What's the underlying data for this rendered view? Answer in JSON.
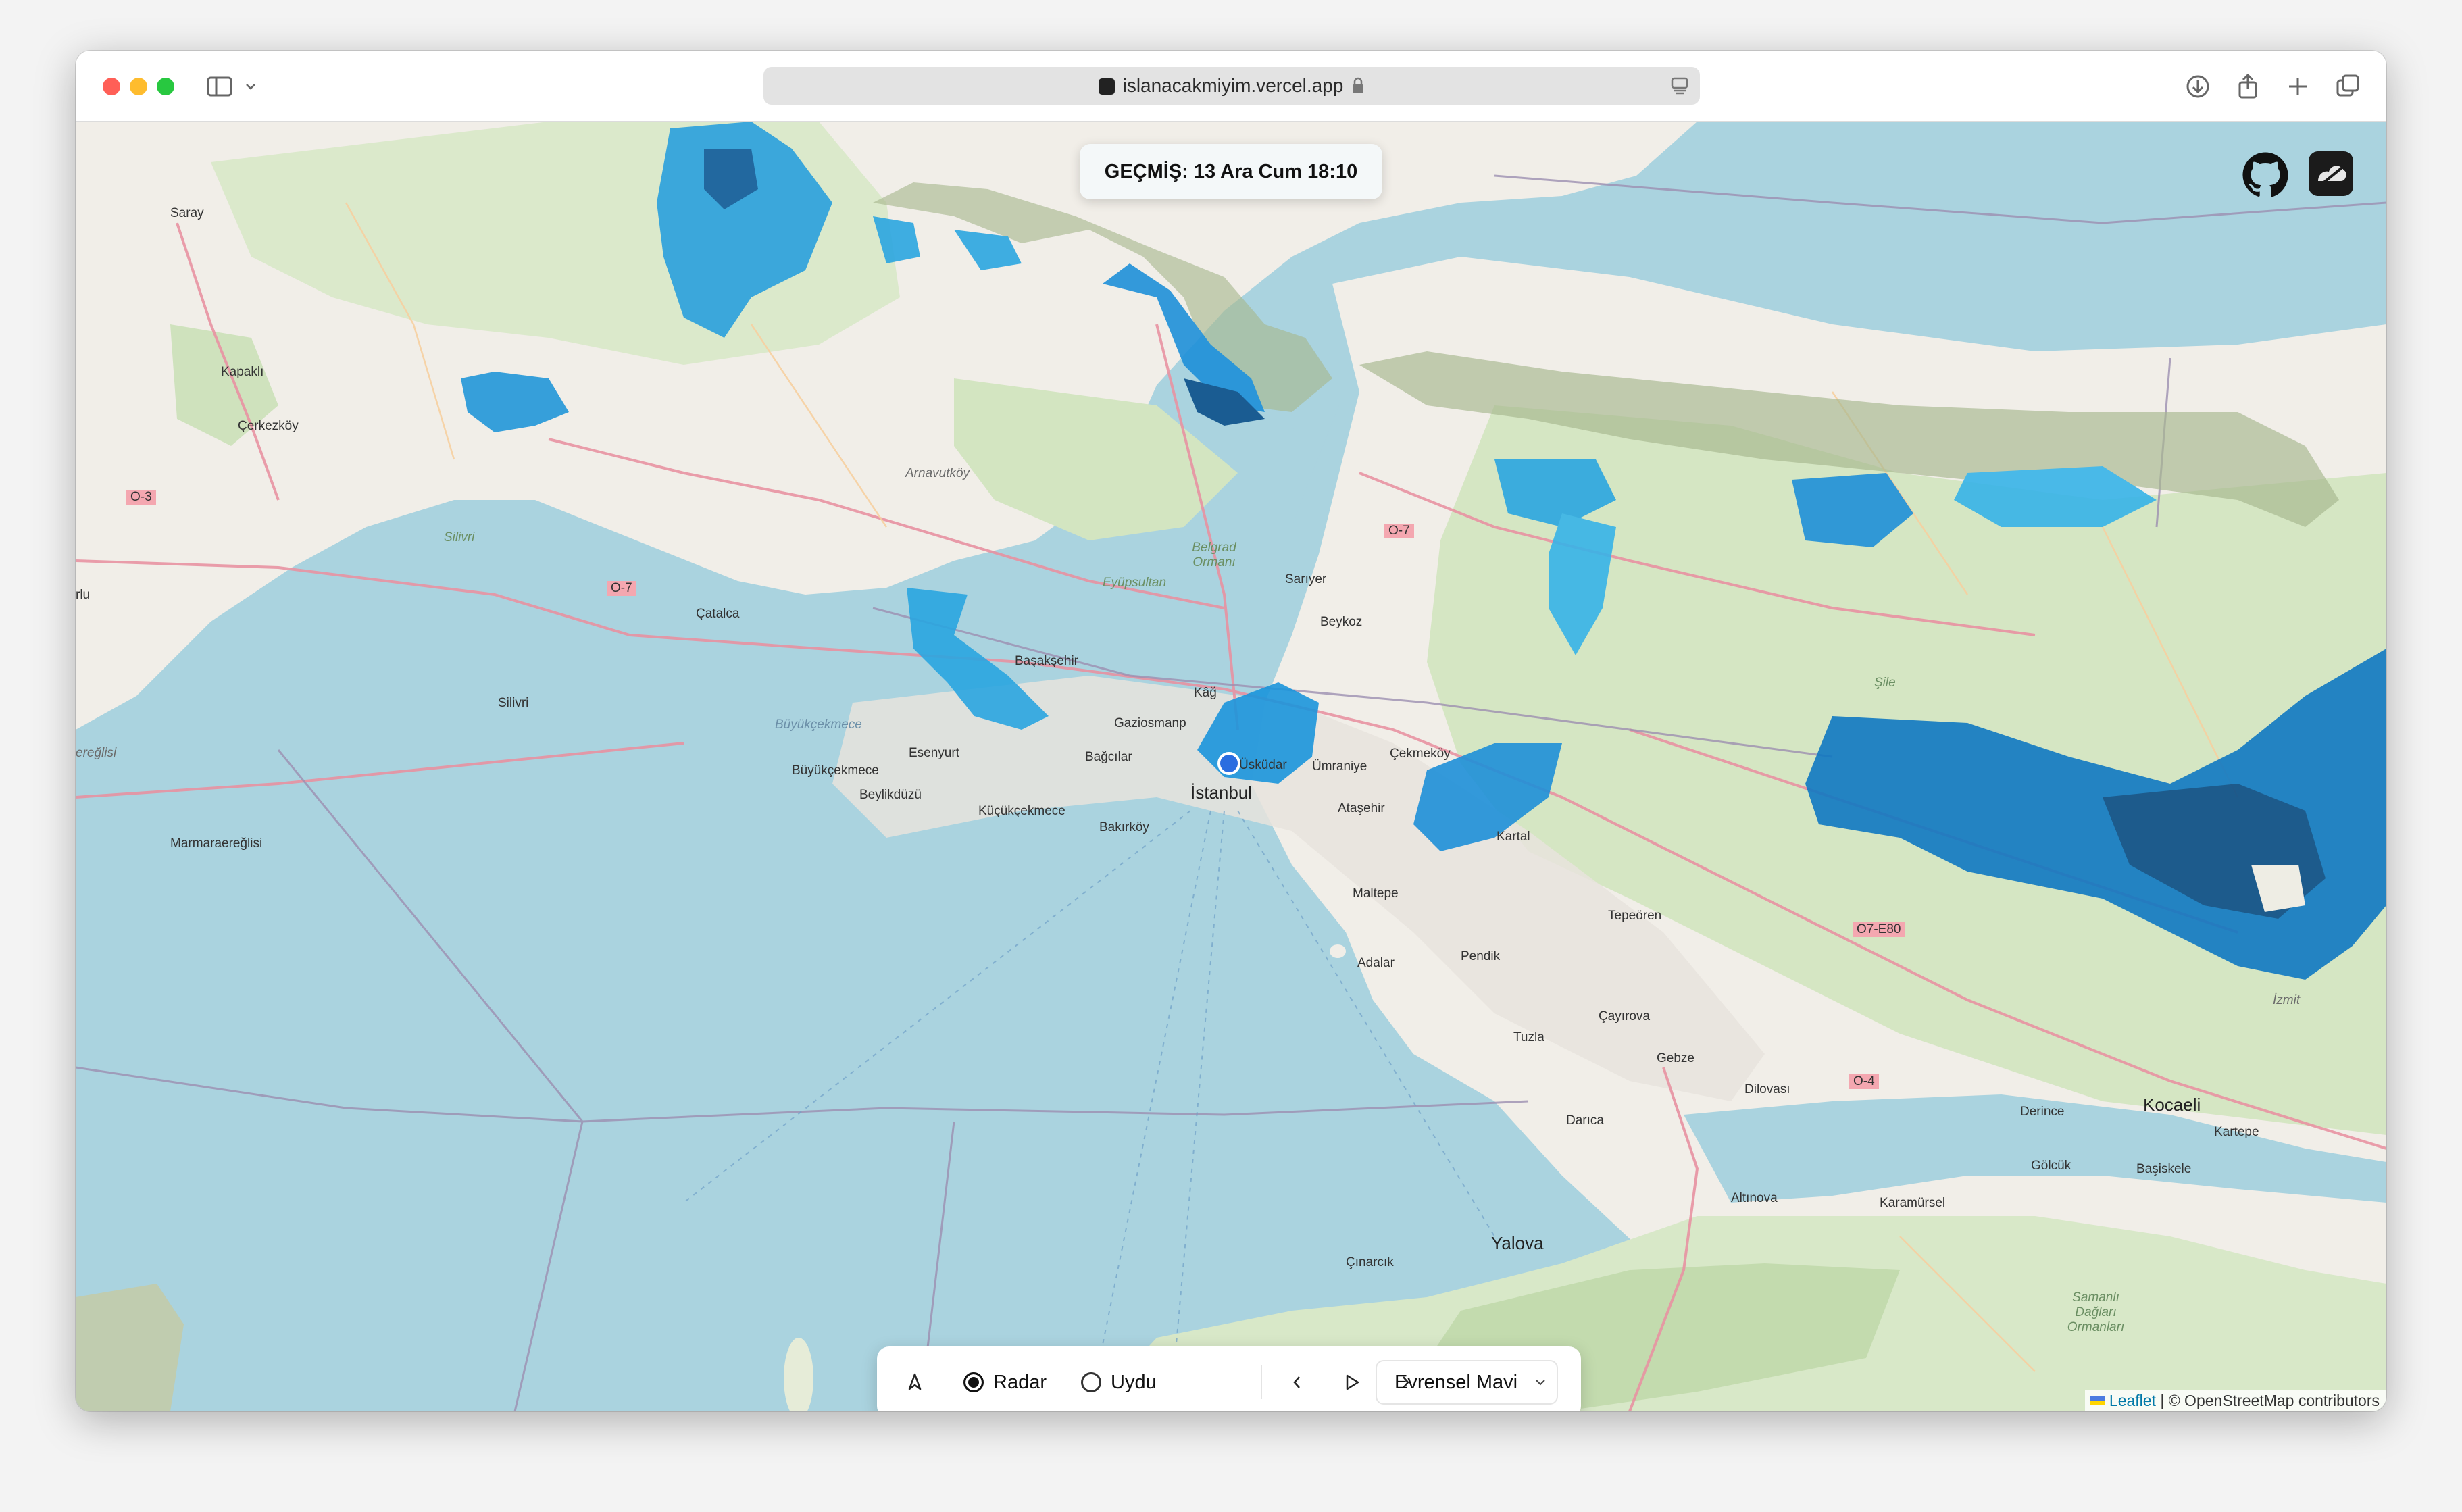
{
  "browser": {
    "url": "islanacakmiyim.vercel.app",
    "traffic_lights": {
      "close": "#ff5f57",
      "minimize": "#febc2e",
      "maximize": "#28c840"
    },
    "icons": [
      "sidebar-icon",
      "chevron-down-icon",
      "lock-icon",
      "reader-icon",
      "download-icon",
      "share-icon",
      "plus-icon",
      "tabs-icon"
    ]
  },
  "overlay": {
    "timestamp": "GEÇMİŞ: 13 Ara Cum 18:10",
    "icons": [
      "github-icon",
      "app-logo-icon"
    ]
  },
  "controls": {
    "locate_icon": "location-icon",
    "radio_options": [
      {
        "label": "Radar",
        "selected": true
      },
      {
        "label": "Uydu",
        "selected": false
      }
    ],
    "playback_icons": [
      "chevron-left-icon",
      "play-icon",
      "chevron-right-icon"
    ],
    "color_scheme": "Evrensel Mavi"
  },
  "map": {
    "labels": {
      "saray": "Saray",
      "kapakli": "Kapaklı",
      "cerkezkoy": "Çerkezköy",
      "o3": "O-3",
      "silivri_dist": "Silivri",
      "o7_west": "O-7",
      "catalca": "Çatalca",
      "silivri": "Silivri",
      "marmaraereglisi": "Marmaraereğlisi",
      "arnavutkoy": "Arnavutköy",
      "belgrad": "Belgrad Ormanı",
      "eyupsultan": "Eyüpsultan",
      "sariyer": "Sarıyer",
      "beykoz": "Beykoz",
      "o7_east": "O-7",
      "basaksehir": "Başakşehir",
      "kagithane": "Kâğ",
      "gaziosmanpasa": "Gaziosmanp",
      "buyukcekmece_lake": "Büyükçekmece",
      "esenyurt": "Esenyurt",
      "buyukcekmece": "Büyükçekmece",
      "beylikduzu": "Beylikdüzü",
      "kucukcekmece": "Küçükçekmece",
      "bagcilar": "Bağcılar",
      "bakirkoy": "Bakırköy",
      "istanbul": "İstanbul",
      "uskudar": "Üsküdar",
      "umraniye": "Ümraniye",
      "cekmekoy": "Çekmeköy",
      "atasehir": "Ataşehir",
      "maltepe": "Maltepe",
      "adalar": "Adalar",
      "kartal": "Kartal",
      "pendik": "Pendik",
      "tuzla": "Tuzla",
      "tepeoren": "Tepeören",
      "cayirova": "Çayırova",
      "gebze": "Gebze",
      "darica": "Darıca",
      "dilovasi": "Dilovası",
      "o4": "O-4",
      "o7e80": "O7-E80",
      "sile": "Şile",
      "derince": "Derince",
      "kocaeli": "Kocaeli",
      "kartepe": "Kartepe",
      "izmit": "İzmit",
      "golcuk": "Gölcük",
      "basiskele": "Başiskele",
      "karamursel": "Karamürsel",
      "altinova": "Altınova",
      "yalova": "Yalova",
      "cinarcik": "Çınarcık",
      "samanli": "Samanlı Dağları Ormanları",
      "arlu": "rlu",
      "ereglisi": "ereğlisi"
    },
    "attribution": {
      "leaflet": "Leaflet",
      "rest": "| © OpenStreetMap contributors"
    }
  }
}
